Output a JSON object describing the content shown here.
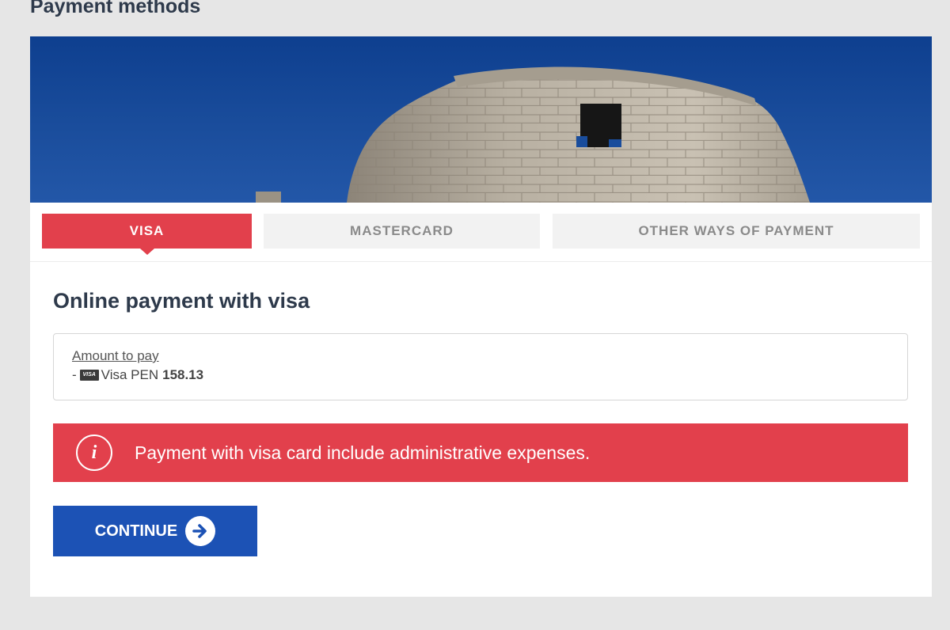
{
  "page": {
    "title": "Payment methods"
  },
  "hero": {
    "image": "stone-tower-ruins-blue-sky"
  },
  "tabs": [
    {
      "label": "VISA",
      "active": true
    },
    {
      "label": "MASTERCARD",
      "active": false
    },
    {
      "label": "OTHER WAYS OF PAYMENT",
      "active": false
    }
  ],
  "payment": {
    "title": "Online payment with visa",
    "amount_label": "Amount to pay",
    "amount_prefix": "-",
    "card_badge": "VISA",
    "card_name": "Visa PEN",
    "amount_value": "158.13"
  },
  "alert": {
    "icon": "info-icon",
    "text": "Payment with visa card include administrative expenses."
  },
  "actions": {
    "continue_label": "CONTINUE",
    "continue_icon": "arrow-right-circle-icon"
  },
  "colors": {
    "accent_red": "#e2404c",
    "button_blue": "#1c52b5",
    "text_dark": "#2e3a4b"
  }
}
